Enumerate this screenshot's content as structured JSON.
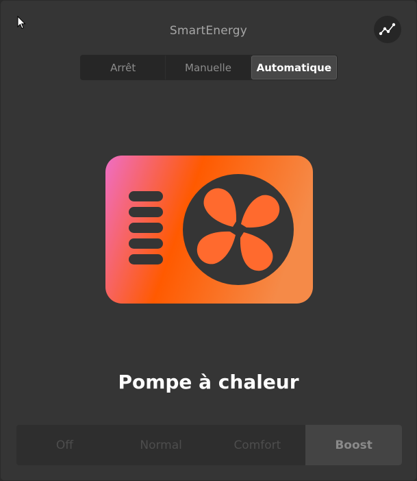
{
  "app": {
    "title": "SmartEnergy"
  },
  "header": {
    "chart_icon": "line-chart-icon"
  },
  "mode_tabs": {
    "items": [
      {
        "label": "Arrêt",
        "active": false
      },
      {
        "label": "Manuelle",
        "active": false
      },
      {
        "label": "Automatique",
        "active": true
      }
    ]
  },
  "device": {
    "icon": "heat-pump-icon",
    "name": "Pompe à chaleur",
    "gradient": [
      "#ef6ec5",
      "#ff5a00",
      "#f58a48"
    ],
    "fan_color": "#ff6a2e"
  },
  "levels": {
    "items": [
      {
        "label": "Off",
        "active": false
      },
      {
        "label": "Normal",
        "active": false
      },
      {
        "label": "Comfort",
        "active": false
      },
      {
        "label": "Boost",
        "active": true
      }
    ]
  }
}
